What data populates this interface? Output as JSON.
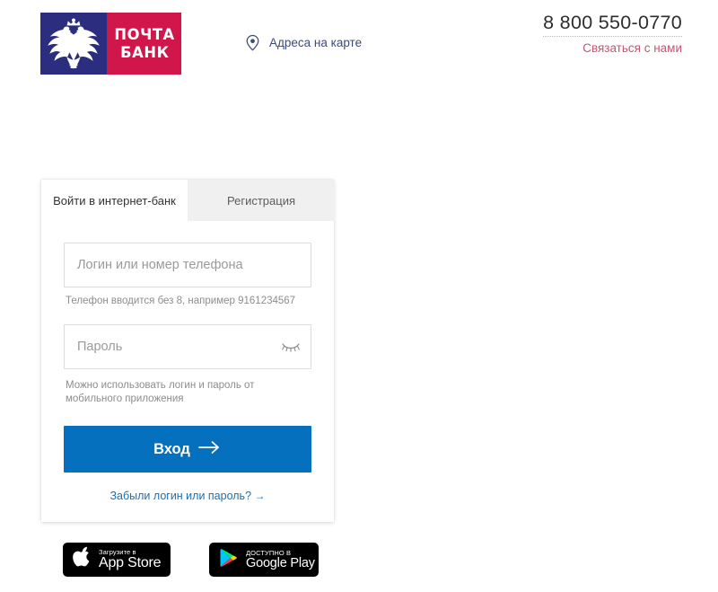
{
  "header": {
    "logo": {
      "emblem_icon": "double-headed-eagle-emblem",
      "word_line1": "ПОЧТА",
      "word_line2": "БАНК",
      "emblem_bg": "#2b2d7f",
      "word_bg": "#d0164a"
    },
    "map_link": {
      "icon": "location-pin-icon",
      "label": "Адреса на карте"
    },
    "contact": {
      "phone": "8 800 550-0770",
      "contact_label": "Связаться с нами",
      "contact_color": "#c4566f"
    }
  },
  "card": {
    "tabs": [
      {
        "label": "Войти в интернет-банк",
        "active": true
      },
      {
        "label": "Регистрация",
        "active": false
      }
    ],
    "login_field": {
      "placeholder": "Логин или номер телефона",
      "value": ""
    },
    "login_hint": "Телефон вводится без 8, например 9161234567",
    "password_field": {
      "placeholder": "Пароль",
      "value": "",
      "toggle_icon": "eye-closed-icon"
    },
    "password_hint": "Можно использовать логин и пароль от мобильного приложения",
    "submit": {
      "label": "Вход",
      "arrow_icon": "arrow-right-icon",
      "color": "#0570bd"
    },
    "forgot_link": {
      "label": "Забыли логин или пароль?",
      "arrow": "→",
      "color": "#1c6fb5"
    }
  },
  "store_badges": [
    {
      "icon": "apple-logo-icon",
      "small": "Загрузите в",
      "big": "App Store"
    },
    {
      "icon": "google-play-triangle-icon",
      "small": "ДОСТУПНО В",
      "big": "Google Play"
    }
  ]
}
